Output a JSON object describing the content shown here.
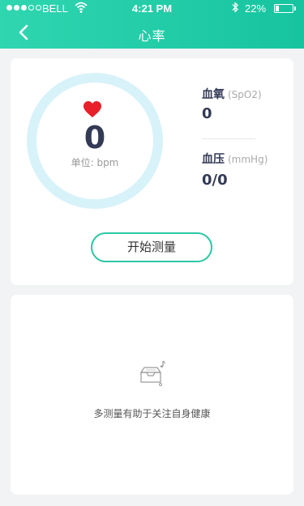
{
  "status_bar": {
    "carrier": "BELL",
    "time": "4:21 PM",
    "battery_percent": "22%",
    "battery_level": 0.22,
    "signal_bars_filled": 3,
    "signal_bars_total": 5
  },
  "nav": {
    "title": "心率",
    "back_icon": "chevron-left-icon"
  },
  "heart_rate": {
    "value": "0",
    "unit_label": "单位: bpm",
    "icon": "heart-icon"
  },
  "metrics": {
    "spo2": {
      "label": "血氧",
      "sub": "(SpO2)",
      "value": "0"
    },
    "blood_pressure": {
      "label": "血压",
      "sub": "(mmHg)",
      "value": "0/0"
    }
  },
  "actions": {
    "start_label": "开始测量"
  },
  "empty_state": {
    "icon": "empty-inbox-icon",
    "text": "多测量有助于关注自身健康"
  },
  "colors": {
    "header_gradient_start": "#2fd6b0",
    "header_gradient_end": "#17c4a0",
    "ring": "#d8f2fa",
    "heart": "#e8202a",
    "button_border": "#2cc7a5",
    "value_text": "#333a55",
    "background": "#f2f3f5"
  }
}
